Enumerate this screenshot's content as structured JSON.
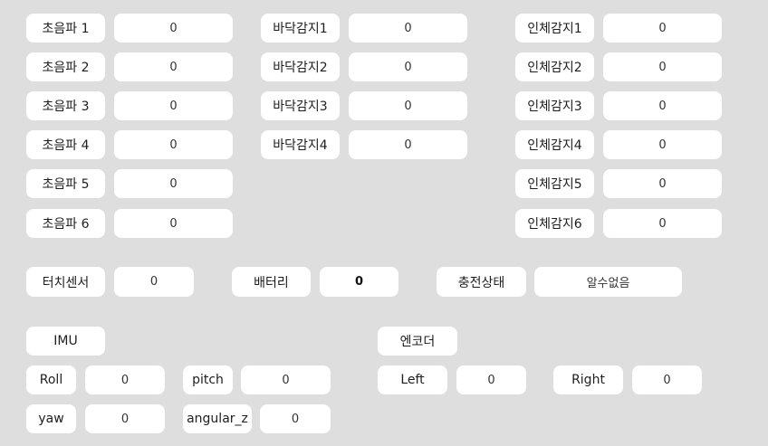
{
  "ultrasonic": [
    {
      "label": "초음파 1",
      "value": "0"
    },
    {
      "label": "초음파 2",
      "value": "0"
    },
    {
      "label": "초음파 3",
      "value": "0"
    },
    {
      "label": "초음파 4",
      "value": "0"
    },
    {
      "label": "초음파 5",
      "value": "0"
    },
    {
      "label": "초음파 6",
      "value": "0"
    }
  ],
  "floor": [
    {
      "label": "바닥감지1",
      "value": "0"
    },
    {
      "label": "바닥감지2",
      "value": "0"
    },
    {
      "label": "바닥감지3",
      "value": "0"
    },
    {
      "label": "바닥감지4",
      "value": "0"
    }
  ],
  "human": [
    {
      "label": "인체감지1",
      "value": "0"
    },
    {
      "label": "인체감지2",
      "value": "0"
    },
    {
      "label": "인체감지3",
      "value": "0"
    },
    {
      "label": "인체감지4",
      "value": "0"
    },
    {
      "label": "인체감지5",
      "value": "0"
    },
    {
      "label": "인체감지6",
      "value": "0"
    }
  ],
  "status": {
    "touch_label": "터치센서",
    "touch_value": "0",
    "battery_label": "배터리",
    "battery_value": "0",
    "charge_label": "충전상태",
    "charge_value": "알수없음"
  },
  "imu": {
    "title": "IMU",
    "roll_label": "Roll",
    "roll_value": "0",
    "pitch_label": "pitch",
    "pitch_value": "0",
    "yaw_label": "yaw",
    "yaw_value": "0",
    "angular_z_label": "angular_z",
    "angular_z_value": "0"
  },
  "encoder": {
    "title": "엔코더",
    "left_label": "Left",
    "left_value": "0",
    "right_label": "Right",
    "right_value": "0"
  }
}
